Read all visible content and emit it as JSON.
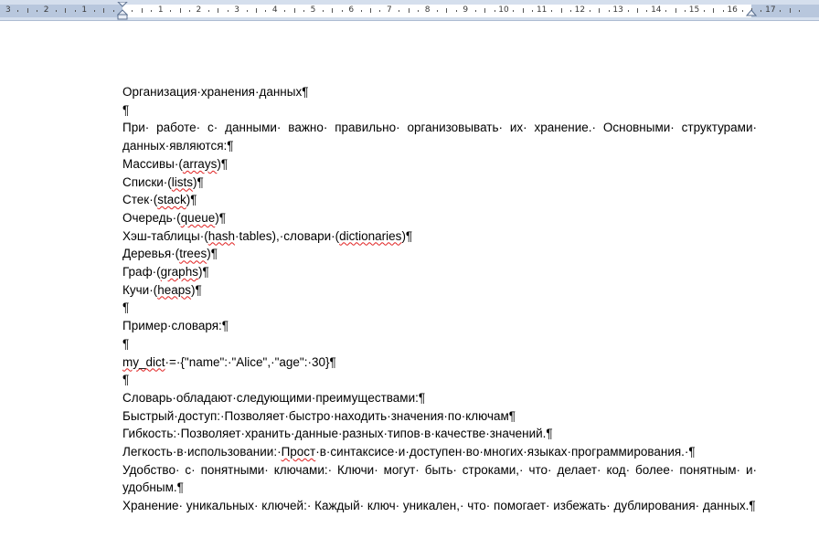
{
  "ruler": {
    "numbers_left": [
      "3",
      "2",
      "1"
    ],
    "numbers_right": [
      "1",
      "2",
      "3",
      "4",
      "5",
      "6",
      "7",
      "8",
      "9",
      "10",
      "11",
      "12",
      "13",
      "14",
      "15",
      "16",
      "17"
    ]
  },
  "document": {
    "paragraphs": [
      "Организация·хранения·данных¶",
      "¶",
      "При· работе· с· данными· важно· правильно· организовывать· их· хранение.· Основными· структурами· данных·являются:¶",
      "Массивы·(arrays)¶",
      "Списки·(lists)¶",
      "Стек·(stack)¶",
      "Очередь·(queue)¶",
      "Хэш-таблицы·(hash·tables),·словари·(dictionaries)¶",
      "Деревья·(trees)¶",
      "Граф·(graphs)¶",
      "Кучи·(heaps)¶",
      "¶",
      "Пример·словаря:¶",
      "¶",
      "my_dict·=·{\"name\":·\"Alice\",·\"age\":·30}¶",
      "¶",
      "Словарь·обладают·следующими·преимуществами:¶",
      "Быстрый·доступ:·Позволяет·быстро·находить·значения·по·ключам¶",
      "Гибкость:·Позволяет·хранить·данные·разных·типов·в·качестве·значений.¶",
      "Легкость·в·использовании:·Прост·в·синтаксисе·и·доступен·во·многих·языках·программирования.·¶",
      "Удобство· с· понятными· ключами:· Ключи· могут· быть· строками,· что· делает· код· более· понятным· и· удобным.¶",
      "Хранение· уникальных· ключей:· Каждый· ключ· уникален,· что· помогает· избежать· дублирования· данных.¶"
    ]
  },
  "colors": {
    "ruler_bg": "#d5dfed",
    "ruler_margin": "#b8c7dd",
    "spell_underline": "#e02020",
    "text": "#000000"
  }
}
